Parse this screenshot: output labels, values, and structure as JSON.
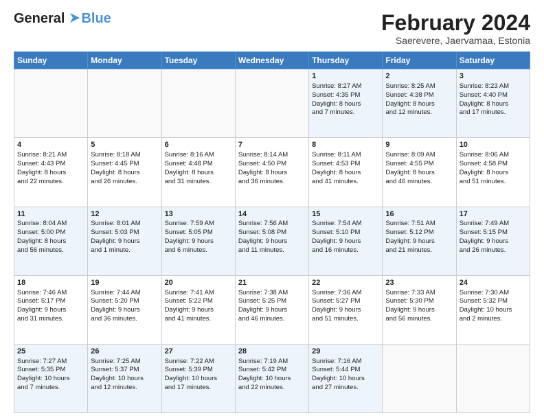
{
  "header": {
    "logo_line1": "General",
    "logo_line2": "Blue",
    "month": "February 2024",
    "location": "Saerevere, Jaervamaa, Estonia"
  },
  "days_of_week": [
    "Sunday",
    "Monday",
    "Tuesday",
    "Wednesday",
    "Thursday",
    "Friday",
    "Saturday"
  ],
  "weeks": [
    [
      {
        "day": "",
        "info": ""
      },
      {
        "day": "",
        "info": ""
      },
      {
        "day": "",
        "info": ""
      },
      {
        "day": "",
        "info": ""
      },
      {
        "day": "1",
        "info": "Sunrise: 8:27 AM\nSunset: 4:35 PM\nDaylight: 8 hours\nand 7 minutes."
      },
      {
        "day": "2",
        "info": "Sunrise: 8:25 AM\nSunset: 4:38 PM\nDaylight: 8 hours\nand 12 minutes."
      },
      {
        "day": "3",
        "info": "Sunrise: 8:23 AM\nSunset: 4:40 PM\nDaylight: 8 hours\nand 17 minutes."
      }
    ],
    [
      {
        "day": "4",
        "info": "Sunrise: 8:21 AM\nSunset: 4:43 PM\nDaylight: 8 hours\nand 22 minutes."
      },
      {
        "day": "5",
        "info": "Sunrise: 8:18 AM\nSunset: 4:45 PM\nDaylight: 8 hours\nand 26 minutes."
      },
      {
        "day": "6",
        "info": "Sunrise: 8:16 AM\nSunset: 4:48 PM\nDaylight: 8 hours\nand 31 minutes."
      },
      {
        "day": "7",
        "info": "Sunrise: 8:14 AM\nSunset: 4:50 PM\nDaylight: 8 hours\nand 36 minutes."
      },
      {
        "day": "8",
        "info": "Sunrise: 8:11 AM\nSunset: 4:53 PM\nDaylight: 8 hours\nand 41 minutes."
      },
      {
        "day": "9",
        "info": "Sunrise: 8:09 AM\nSunset: 4:55 PM\nDaylight: 8 hours\nand 46 minutes."
      },
      {
        "day": "10",
        "info": "Sunrise: 8:06 AM\nSunset: 4:58 PM\nDaylight: 8 hours\nand 51 minutes."
      }
    ],
    [
      {
        "day": "11",
        "info": "Sunrise: 8:04 AM\nSunset: 5:00 PM\nDaylight: 8 hours\nand 56 minutes."
      },
      {
        "day": "12",
        "info": "Sunrise: 8:01 AM\nSunset: 5:03 PM\nDaylight: 9 hours\nand 1 minute."
      },
      {
        "day": "13",
        "info": "Sunrise: 7:59 AM\nSunset: 5:05 PM\nDaylight: 9 hours\nand 6 minutes."
      },
      {
        "day": "14",
        "info": "Sunrise: 7:56 AM\nSunset: 5:08 PM\nDaylight: 9 hours\nand 11 minutes."
      },
      {
        "day": "15",
        "info": "Sunrise: 7:54 AM\nSunset: 5:10 PM\nDaylight: 9 hours\nand 16 minutes."
      },
      {
        "day": "16",
        "info": "Sunrise: 7:51 AM\nSunset: 5:12 PM\nDaylight: 9 hours\nand 21 minutes."
      },
      {
        "day": "17",
        "info": "Sunrise: 7:49 AM\nSunset: 5:15 PM\nDaylight: 9 hours\nand 26 minutes."
      }
    ],
    [
      {
        "day": "18",
        "info": "Sunrise: 7:46 AM\nSunset: 5:17 PM\nDaylight: 9 hours\nand 31 minutes."
      },
      {
        "day": "19",
        "info": "Sunrise: 7:44 AM\nSunset: 5:20 PM\nDaylight: 9 hours\nand 36 minutes."
      },
      {
        "day": "20",
        "info": "Sunrise: 7:41 AM\nSunset: 5:22 PM\nDaylight: 9 hours\nand 41 minutes."
      },
      {
        "day": "21",
        "info": "Sunrise: 7:38 AM\nSunset: 5:25 PM\nDaylight: 9 hours\nand 46 minutes."
      },
      {
        "day": "22",
        "info": "Sunrise: 7:36 AM\nSunset: 5:27 PM\nDaylight: 9 hours\nand 51 minutes."
      },
      {
        "day": "23",
        "info": "Sunrise: 7:33 AM\nSunset: 5:30 PM\nDaylight: 9 hours\nand 56 minutes."
      },
      {
        "day": "24",
        "info": "Sunrise: 7:30 AM\nSunset: 5:32 PM\nDaylight: 10 hours\nand 2 minutes."
      }
    ],
    [
      {
        "day": "25",
        "info": "Sunrise: 7:27 AM\nSunset: 5:35 PM\nDaylight: 10 hours\nand 7 minutes."
      },
      {
        "day": "26",
        "info": "Sunrise: 7:25 AM\nSunset: 5:37 PM\nDaylight: 10 hours\nand 12 minutes."
      },
      {
        "day": "27",
        "info": "Sunrise: 7:22 AM\nSunset: 5:39 PM\nDaylight: 10 hours\nand 17 minutes."
      },
      {
        "day": "28",
        "info": "Sunrise: 7:19 AM\nSunset: 5:42 PM\nDaylight: 10 hours\nand 22 minutes."
      },
      {
        "day": "29",
        "info": "Sunrise: 7:16 AM\nSunset: 5:44 PM\nDaylight: 10 hours\nand 27 minutes."
      },
      {
        "day": "",
        "info": ""
      },
      {
        "day": "",
        "info": ""
      }
    ]
  ]
}
